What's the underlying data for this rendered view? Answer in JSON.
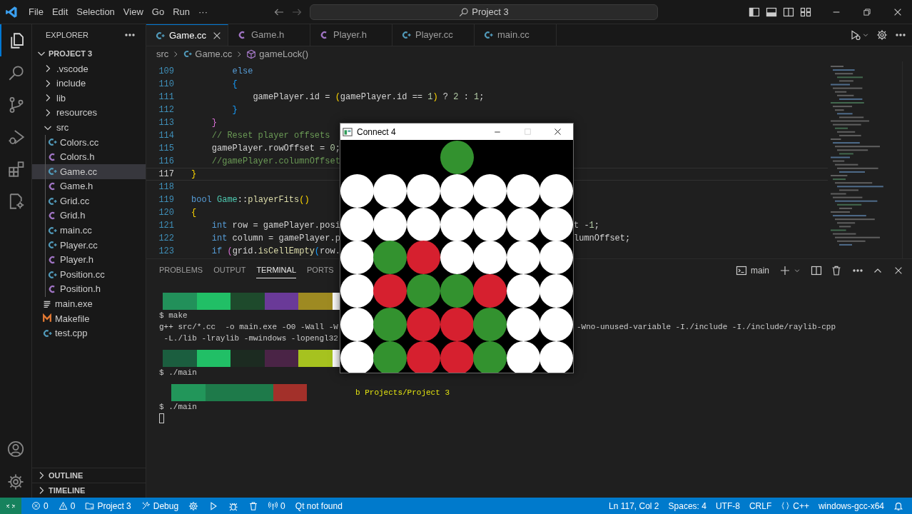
{
  "title_bar": {
    "menu": [
      "File",
      "Edit",
      "Selection",
      "View",
      "Go",
      "Run",
      "···"
    ],
    "command_center": "Project 3"
  },
  "activity_bar": {
    "top": [
      {
        "kind": "explorer",
        "selected": true
      },
      {
        "kind": "search",
        "selected": false
      },
      {
        "kind": "source_control",
        "selected": false
      },
      {
        "kind": "run_debug",
        "selected": false
      },
      {
        "kind": "extensions",
        "selected": false
      },
      {
        "kind": "remote",
        "selected": false
      }
    ],
    "bottom": [
      {
        "kind": "account"
      },
      {
        "kind": "manage"
      }
    ]
  },
  "explorer": {
    "title": "EXPLORER",
    "root": {
      "label": "PROJECT 3",
      "expanded": true,
      "children": [
        {
          "label": ".vscode",
          "kind": "folder",
          "expanded": false,
          "selected": false
        },
        {
          "label": "include",
          "kind": "folder",
          "expanded": false,
          "selected": false
        },
        {
          "label": "lib",
          "kind": "folder",
          "expanded": false,
          "selected": false
        },
        {
          "label": "resources",
          "kind": "folder",
          "expanded": false,
          "selected": false
        },
        {
          "label": "src",
          "kind": "folder",
          "expanded": true,
          "selected": false,
          "children": [
            {
              "label": "Colors.cc",
              "kind": "cpp",
              "selected": false
            },
            {
              "label": "Colors.h",
              "kind": "h",
              "selected": false
            },
            {
              "label": "Game.cc",
              "kind": "cpp",
              "selected": true
            },
            {
              "label": "Game.h",
              "kind": "h",
              "selected": false
            },
            {
              "label": "Grid.cc",
              "kind": "cpp",
              "selected": false
            },
            {
              "label": "Grid.h",
              "kind": "h",
              "selected": false
            },
            {
              "label": "main.cc",
              "kind": "cpp",
              "selected": false
            },
            {
              "label": "Player.cc",
              "kind": "cpp",
              "selected": false
            },
            {
              "label": "Player.h",
              "kind": "h",
              "selected": false
            },
            {
              "label": "Position.cc",
              "kind": "cpp",
              "selected": false
            },
            {
              "label": "Position.h",
              "kind": "h",
              "selected": false
            }
          ]
        },
        {
          "label": "main.exe",
          "kind": "exe",
          "selected": false
        },
        {
          "label": "Makefile",
          "kind": "makefile",
          "selected": false
        },
        {
          "label": "test.cpp",
          "kind": "cpp",
          "selected": false
        }
      ]
    },
    "sections": [
      {
        "label": "OUTLINE",
        "expanded": false
      },
      {
        "label": "TIMELINE",
        "expanded": false
      }
    ]
  },
  "tabs": [
    {
      "label": "Game.cc",
      "kind": "cpp",
      "selected": true
    },
    {
      "label": "Game.h",
      "kind": "h",
      "selected": false
    },
    {
      "label": "Player.h",
      "kind": "h",
      "selected": false
    },
    {
      "label": "Player.cc",
      "kind": "cpp",
      "selected": false
    },
    {
      "label": "main.cc",
      "kind": "cpp",
      "selected": false
    }
  ],
  "breadcrumbs": [
    {
      "label": "src",
      "kind": "folder"
    },
    {
      "label": "Game.cc",
      "kind": "cpp"
    },
    {
      "label": "gameLock()",
      "kind": "method"
    }
  ],
  "code": [
    {
      "number": "109",
      "active": false,
      "tokens": [
        {
          "text": "        else",
          "kind": "keyword"
        }
      ]
    },
    {
      "number": "110",
      "active": false,
      "tokens": [
        {
          "text": "        {",
          "kind": "bracket3"
        }
      ]
    },
    {
      "number": "111",
      "active": false,
      "tokens": [
        {
          "text": "            gamePlayer.id = ",
          "kind": "plain"
        },
        {
          "text": "(",
          "kind": "bracket1"
        },
        {
          "text": "gamePlayer.id == ",
          "kind": "plain"
        },
        {
          "text": "1",
          "kind": "number"
        },
        {
          "text": ")",
          "kind": "bracket1"
        },
        {
          "text": " ? ",
          "kind": "plain"
        },
        {
          "text": "2",
          "kind": "number"
        },
        {
          "text": " : ",
          "kind": "plain"
        },
        {
          "text": "1",
          "kind": "number"
        },
        {
          "text": ";",
          "kind": "plain"
        }
      ]
    },
    {
      "number": "112",
      "active": false,
      "tokens": [
        {
          "text": "        }",
          "kind": "bracket3"
        }
      ]
    },
    {
      "number": "113",
      "active": false,
      "tokens": [
        {
          "text": "    }",
          "kind": "bracket2"
        }
      ]
    },
    {
      "number": "114",
      "active": false,
      "tokens": [
        {
          "text": "    // Reset player offsets",
          "kind": "comment"
        }
      ]
    },
    {
      "number": "115",
      "active": false,
      "tokens": [
        {
          "text": "    gamePlayer.rowOffset = ",
          "kind": "plain"
        },
        {
          "text": "0",
          "kind": "number"
        },
        {
          "text": ";",
          "kind": "plain"
        }
      ]
    },
    {
      "number": "116",
      "active": false,
      "tokens": [
        {
          "text": "    //gamePlayer.columnOffset",
          "kind": "comment"
        }
      ]
    },
    {
      "number": "117",
      "active": true,
      "tokens": [
        {
          "text": "}",
          "kind": "bracket1"
        }
      ]
    },
    {
      "number": "118",
      "active": false
    },
    {
      "number": "119",
      "active": false,
      "tokens": [
        {
          "text": "bool",
          "kind": "keyword"
        },
        {
          "text": " Game",
          "kind": "type"
        },
        {
          "text": "::",
          "kind": "plain"
        },
        {
          "text": "playerFits",
          "kind": "function"
        },
        {
          "text": "()",
          "kind": "bracket1"
        }
      ]
    },
    {
      "number": "120",
      "active": false,
      "tokens": [
        {
          "text": "{",
          "kind": "bracket1"
        }
      ]
    },
    {
      "number": "121",
      "active": false,
      "tokens": [
        {
          "text": "    int",
          "kind": "keyword"
        },
        {
          "text": " row = gamePlayer.posi",
          "kind": "plain"
        }
      ],
      "right": [
        {
          "text": "t -",
          "kind": "plain"
        },
        {
          "text": "1",
          "kind": "number"
        },
        {
          "text": ";",
          "kind": "plain"
        }
      ]
    },
    {
      "number": "122",
      "active": false,
      "tokens": [
        {
          "text": "    int",
          "kind": "keyword"
        },
        {
          "text": " column = gamePlayer.p",
          "kind": "plain"
        }
      ],
      "right": [
        {
          "text": "lumnOffset;",
          "kind": "plain"
        }
      ]
    },
    {
      "number": "123",
      "active": false,
      "tokens": [
        {
          "text": "    if",
          "kind": "keyword"
        },
        {
          "text": " (",
          "kind": "bracket2"
        },
        {
          "text": "grid.",
          "kind": "plain"
        },
        {
          "text": "isCellEmpty",
          "kind": "function"
        },
        {
          "text": "(",
          "kind": "bracket3"
        },
        {
          "text": "row.",
          "kind": "plain"
        }
      ]
    }
  ],
  "panel": {
    "tabs": [
      {
        "label": "PROBLEMS",
        "selected": false
      },
      {
        "label": "OUTPUT",
        "selected": false
      },
      {
        "label": "TERMINAL",
        "selected": true
      },
      {
        "label": "PORTS",
        "selected": false
      }
    ],
    "terminal_name": "main"
  },
  "terminal": [
    {
      "kind": "bar",
      "segments": [
        {
          "color": "#22905a"
        },
        {
          "color": "#21bf66"
        },
        {
          "color": "#1e4a2c"
        },
        {
          "color": "#6a3a98"
        },
        {
          "color": "#9e8a22"
        },
        {
          "color": "#ffffff"
        }
      ]
    },
    {
      "kind": "text",
      "text": "$ make"
    },
    {
      "kind": "text",
      "text": "g++ src/*.cc  -o main.exe -O0 -Wall -W",
      "right": "-Wno-unused-variable -I./include -I./include/raylib-cpp"
    },
    {
      "kind": "text",
      "text": " -L./lib -lraylib -mwindows -lopengl32"
    },
    {
      "kind": "bar",
      "segments": [
        {
          "color": "#1b5e3f"
        },
        {
          "color": "#21bf66"
        },
        {
          "color": "#1c2b21"
        },
        {
          "color": "#4a2446"
        },
        {
          "color": "#a6c21f"
        },
        {
          "color": "#ffffff"
        }
      ]
    },
    {
      "kind": "text",
      "text": "$ ./main"
    },
    {
      "kind": "bar",
      "path": "b Projects/Project 3",
      "segments": [
        {
          "color": "#22965a"
        },
        {
          "color": "#1e7a4a"
        },
        {
          "color": "#1e7a4a"
        },
        {
          "color": "#a3302a"
        }
      ]
    },
    {
      "kind": "text",
      "text": "$ ./main"
    },
    {
      "kind": "cursor"
    }
  ],
  "game_window": {
    "title": "Connect 4",
    "maximizable": false,
    "drop_row": [
      {
        "filled": false
      },
      {
        "filled": false
      },
      {
        "filled": false
      },
      {
        "filled": true,
        "color": "#33922f"
      },
      {
        "filled": false
      },
      {
        "filled": false
      },
      {
        "filled": false
      }
    ],
    "board": [
      [
        {
          "color": "#ffffff"
        },
        {
          "color": "#ffffff"
        },
        {
          "color": "#ffffff"
        },
        {
          "color": "#ffffff"
        },
        {
          "color": "#ffffff"
        },
        {
          "color": "#ffffff"
        },
        {
          "color": "#ffffff"
        }
      ],
      [
        {
          "color": "#ffffff"
        },
        {
          "color": "#ffffff"
        },
        {
          "color": "#ffffff"
        },
        {
          "color": "#ffffff"
        },
        {
          "color": "#ffffff"
        },
        {
          "color": "#ffffff"
        },
        {
          "color": "#ffffff"
        }
      ],
      [
        {
          "color": "#ffffff"
        },
        {
          "color": "#33922f"
        },
        {
          "color": "#d6202f"
        },
        {
          "color": "#ffffff"
        },
        {
          "color": "#ffffff"
        },
        {
          "color": "#ffffff"
        },
        {
          "color": "#ffffff"
        }
      ],
      [
        {
          "color": "#ffffff"
        },
        {
          "color": "#d6202f"
        },
        {
          "color": "#33922f"
        },
        {
          "color": "#33922f"
        },
        {
          "color": "#d6202f"
        },
        {
          "color": "#ffffff"
        },
        {
          "color": "#ffffff"
        }
      ],
      [
        {
          "color": "#ffffff"
        },
        {
          "color": "#33922f"
        },
        {
          "color": "#d6202f"
        },
        {
          "color": "#d6202f"
        },
        {
          "color": "#33922f"
        },
        {
          "color": "#ffffff"
        },
        {
          "color": "#ffffff"
        }
      ],
      [
        {
          "color": "#ffffff"
        },
        {
          "color": "#33922f"
        },
        {
          "color": "#d6202f"
        },
        {
          "color": "#d6202f"
        },
        {
          "color": "#33922f"
        },
        {
          "color": "#ffffff"
        },
        {
          "color": "#ffffff"
        }
      ]
    ]
  },
  "status_bar": {
    "left": [
      {
        "kind": "errors",
        "text": "0"
      },
      {
        "kind": "warnings",
        "text": "0"
      },
      {
        "kind": "project",
        "text": "Project 3"
      },
      {
        "kind": "build",
        "text": "Debug"
      },
      {
        "kind": "settings"
      },
      {
        "kind": "run"
      },
      {
        "kind": "debug"
      },
      {
        "kind": "clean"
      },
      {
        "kind": "ports",
        "text": "0"
      },
      {
        "kind": "plain",
        "text": "Qt not found"
      }
    ],
    "right": [
      {
        "kind": "plain",
        "text": "Ln 117, Col 2"
      },
      {
        "kind": "plain",
        "text": "Spaces: 4"
      },
      {
        "kind": "plain",
        "text": "UTF-8"
      },
      {
        "kind": "plain",
        "text": "CRLF"
      },
      {
        "kind": "language",
        "text": "C++"
      },
      {
        "kind": "plain",
        "text": "windows-gcc-x64"
      },
      {
        "kind": "notifications"
      }
    ]
  }
}
